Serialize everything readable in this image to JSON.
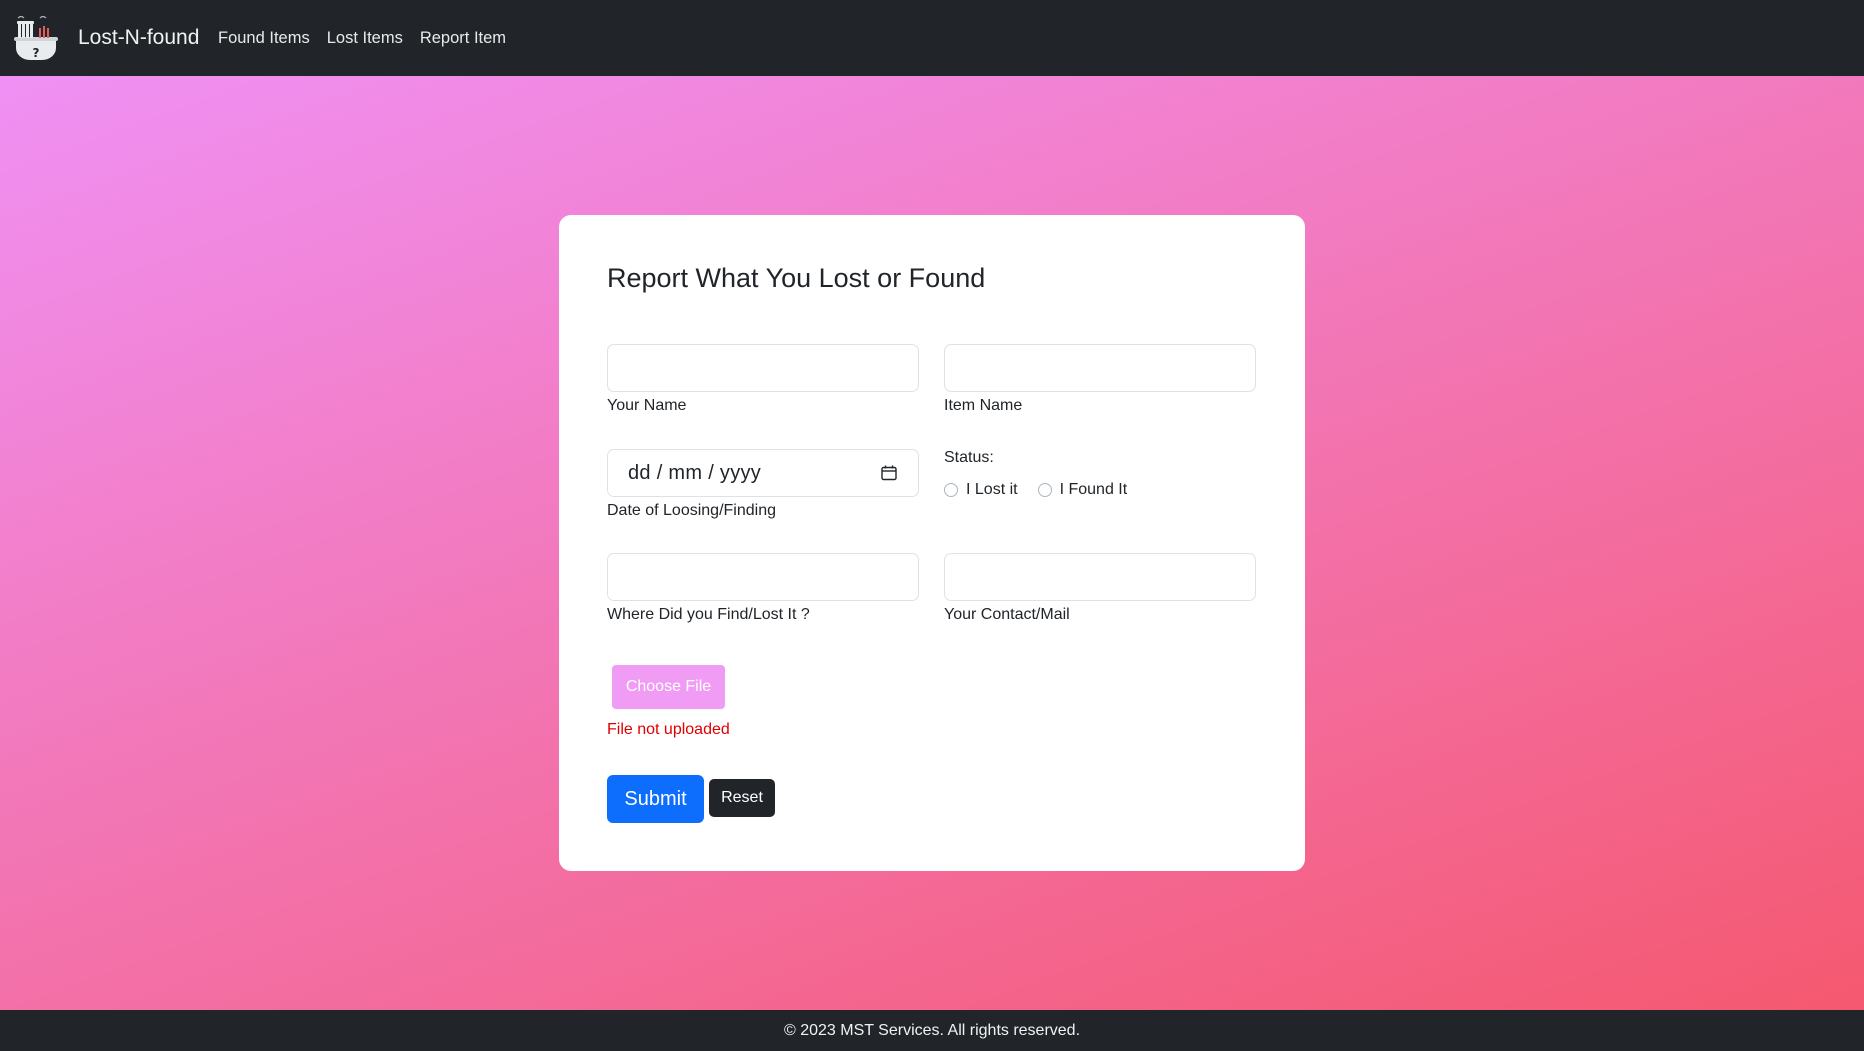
{
  "navbar": {
    "brand": "Lost-N-found",
    "links": [
      "Found Items",
      "Lost Items",
      "Report Item"
    ]
  },
  "form": {
    "title": "Report What You Lost or Found",
    "your_name": {
      "value": "",
      "label": "Your Name"
    },
    "item_name": {
      "value": "",
      "label": "Item Name"
    },
    "date": {
      "placeholder": "dd / mm / yyyy",
      "label": "Date of Loosing/Finding"
    },
    "status": {
      "label": "Status:",
      "options": [
        "I Lost it",
        "I Found It"
      ]
    },
    "location": {
      "value": "",
      "label": "Where Did you Find/Lost It ?"
    },
    "contact": {
      "value": "",
      "label": "Your Contact/Mail"
    },
    "file_button": "Choose File",
    "file_status": "File not uploaded",
    "submit": "Submit",
    "reset": "Reset"
  },
  "footer": {
    "text": "© 2023 MST Services. All rights reserved."
  },
  "colors": {
    "gradient_start": "#f093fb",
    "gradient_end": "#f5576c",
    "navbar_bg": "#212529",
    "submit_bg": "#0d6efd",
    "file_button_bg": "#f09cf5",
    "error_text": "#e00000"
  },
  "icons": [
    "lost-found-logo-icon",
    "calendar-icon"
  ]
}
